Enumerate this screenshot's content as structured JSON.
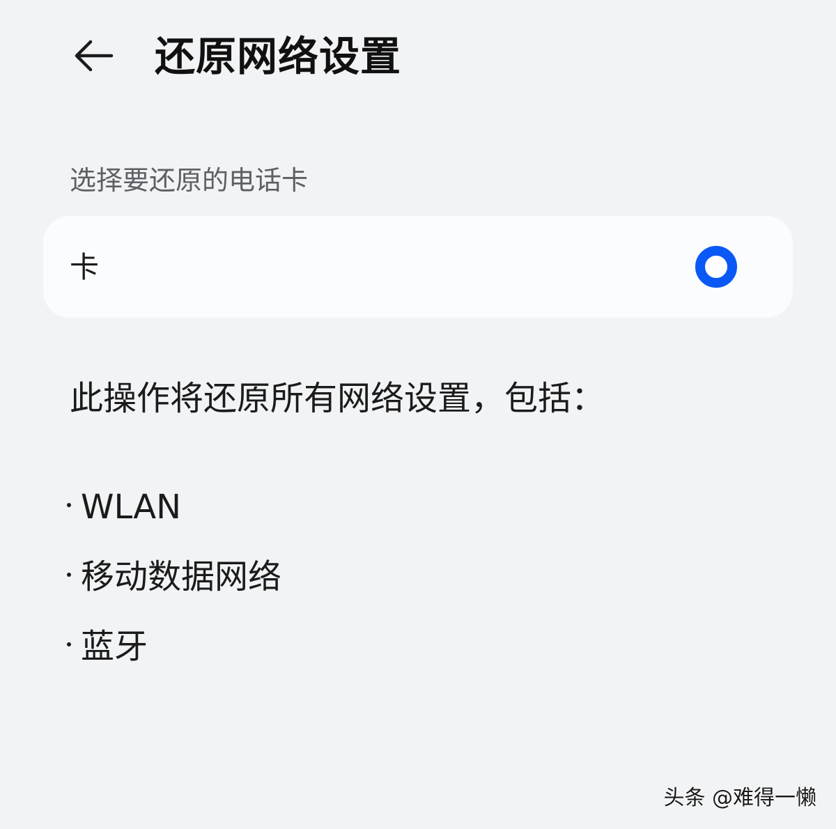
{
  "header": {
    "back_icon": "arrow-left-icon",
    "title": "还原网络设置"
  },
  "sim_section": {
    "label": "选择要还原的电话卡",
    "option": {
      "label": "卡",
      "selected": true,
      "accent_color": "#0a59f7"
    }
  },
  "description": "此操作将还原所有网络设置，包括：",
  "reset_items": [
    {
      "label": "WLAN"
    },
    {
      "label": "移动数据网络"
    },
    {
      "label": "蓝牙"
    }
  ],
  "watermark": "头条 @难得一懒"
}
